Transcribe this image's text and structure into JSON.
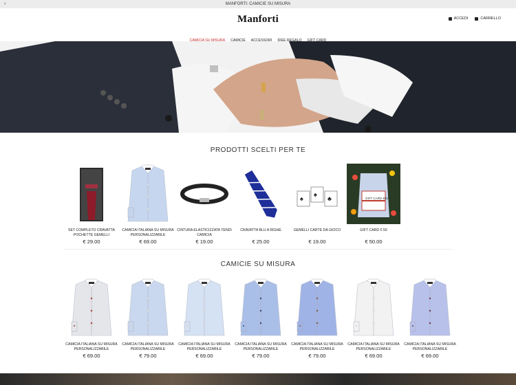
{
  "announcement": {
    "text": "MANFORTI: CAMICIE SU MISURA",
    "arrow": "›"
  },
  "header": {
    "logo": "Manforti",
    "login_label": "ACCEDI",
    "cart_label": "CARRELLO"
  },
  "nav": {
    "items": [
      {
        "label": "CAMICIA SU MISURA",
        "active": true
      },
      {
        "label": "CAMICIE",
        "active": false
      },
      {
        "label": "ACCESSORI",
        "active": false
      },
      {
        "label": "IDEE REGALO",
        "active": false
      },
      {
        "label": "GIFT CARD",
        "active": false
      }
    ]
  },
  "section1": {
    "title": "PRODOTTI SCELTI PER TE",
    "products": [
      {
        "name": "SET COMPLETO CRAVATTA POCHETTE GEMELLI",
        "price": "€ 29.00",
        "kind": "tie-box"
      },
      {
        "name": "CAMICIA ITALIANA SU MISURA PERSONALIZZABILE",
        "price": "€ 69.00",
        "kind": "shirt-blue"
      },
      {
        "name": "CINTURA ELASTICIZZATA TENDI CAMICIA",
        "price": "€ 19.00",
        "kind": "belt"
      },
      {
        "name": "CRAVATTA BLU A RIGHE",
        "price": "€ 25.00",
        "kind": "tie"
      },
      {
        "name": "GEMELLI CARTE DA GIOCO",
        "price": "€ 19.00",
        "kind": "cufflinks"
      },
      {
        "name": "GIFT CARD € 50",
        "price": "€ 50.00",
        "kind": "giftcard",
        "card_label": "GIFT CARD €50"
      }
    ]
  },
  "section2": {
    "title": "CAMICIE SU MISURA",
    "products": [
      {
        "name": "CAMICIA ITALIANA SU MISURA PERSONALIZZABILE",
        "price": "€ 69.00",
        "shirt": "#e4e6ea",
        "btn": "#c0392b"
      },
      {
        "name": "CAMICIA ITALIANA SU MISURA PERSONALIZZABILE",
        "price": "€ 79.00",
        "shirt": "#c9d8ee",
        "btn": "#ffffff"
      },
      {
        "name": "CAMICIA ITALIANA SU MISURA PERSONALIZZABILE",
        "price": "€ 69.00",
        "shirt": "#d5e2f3",
        "btn": "#ffffff"
      },
      {
        "name": "CAMICIA ITALIANA SU MISURA PERSONALIZZABILE",
        "price": "€ 79.00",
        "shirt": "#a9bfe8",
        "btn": "#2c3e70"
      },
      {
        "name": "CAMICIA ITALIANA SU MISURA PERSONALIZZABILE",
        "price": "€ 79.00",
        "shirt": "#9fb3e6",
        "btn": "#8e5a3a"
      },
      {
        "name": "CAMICIA ITALIANA SU MISURA PERSONALIZZABILE",
        "price": "€ 69.00",
        "shirt": "#f2f2f2",
        "btn": "#ffffff"
      },
      {
        "name": "CAMICIA ITALIANA SU MISURA PERSONALIZZABILE",
        "price": "€ 69.00",
        "shirt": "#b7c1ea",
        "btn": "#7a2a4a"
      }
    ]
  }
}
